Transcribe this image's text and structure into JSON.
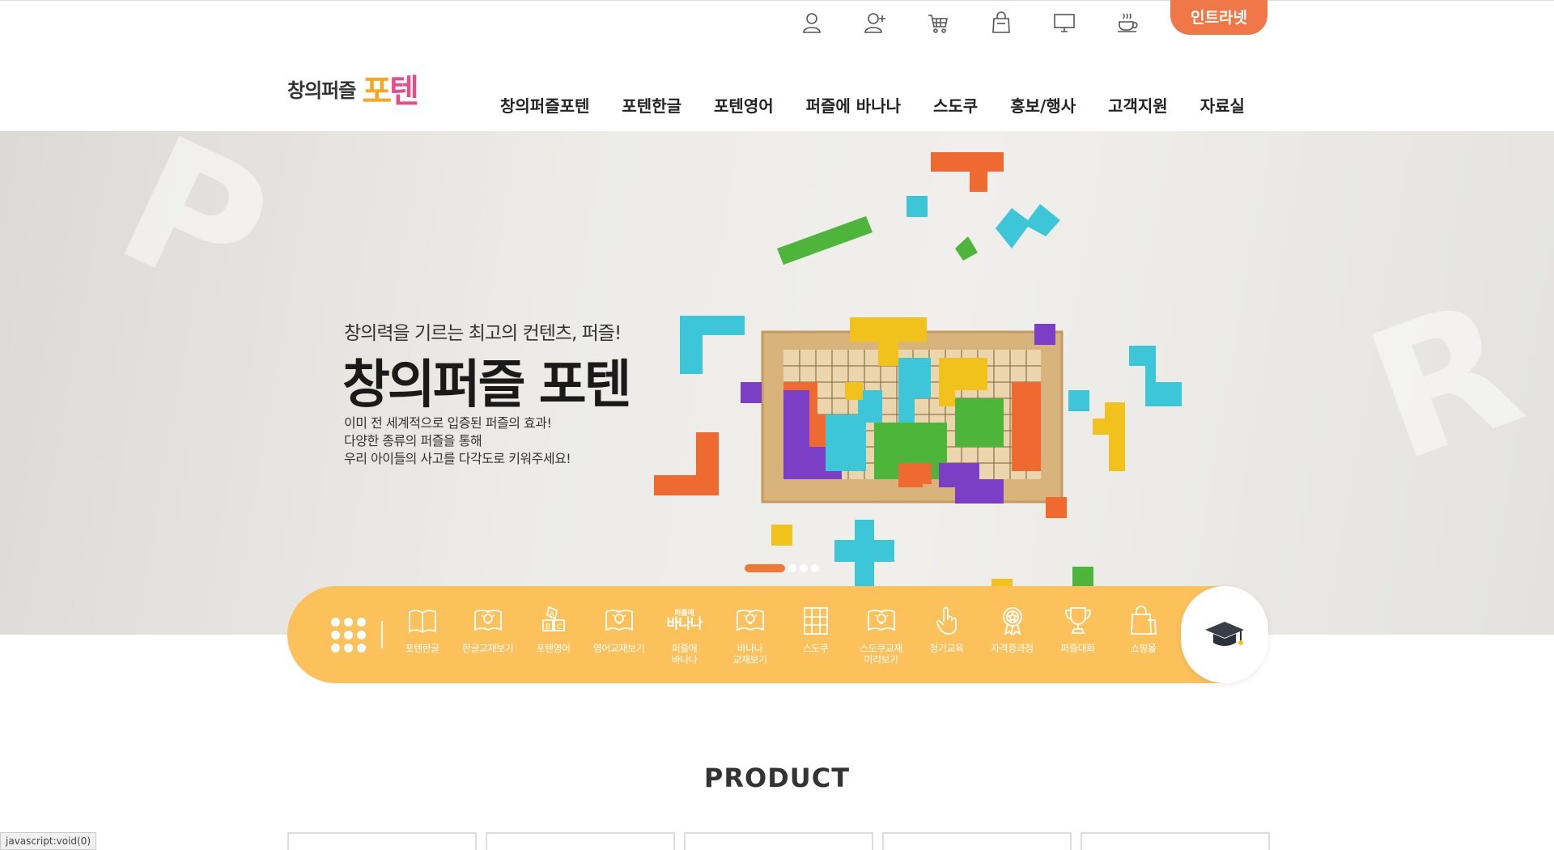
{
  "utility": {
    "icons": [
      "user-icon",
      "user-add-icon",
      "cart-icon",
      "shopping-bag-icon",
      "monitor-icon",
      "coffee-cup-icon"
    ],
    "intranet_label": "인트라넷"
  },
  "logo": {
    "text": "창의퍼즐",
    "mark_1": "포",
    "mark_2": "텐"
  },
  "nav": [
    "창의퍼즐포텐",
    "포텐한글",
    "포텐영어",
    "퍼즐에 바나나",
    "스도쿠",
    "홍보/행사",
    "고객지원",
    "자료실"
  ],
  "hero": {
    "subtitle": "창의력을 기르는 최고의 컨텐츠, 퍼즐!",
    "title": "창의퍼즐 포텐",
    "desc": [
      "이미 전 세계적으로 입증된 퍼즐의 효과!",
      "다양한 종류의 퍼즐을 통해",
      "우리 아이들의 사고를 다각도로 키워주세요!"
    ],
    "slider_active": 1,
    "slider_count": 4
  },
  "quick_menu": {
    "items": [
      {
        "label": "포텐한글",
        "icon": "book-icon"
      },
      {
        "label": "한글교재보기",
        "icon": "bulb-book-icon"
      },
      {
        "label": "포텐영어",
        "icon": "abc-blocks-icon"
      },
      {
        "label": "영어교재보기",
        "icon": "bulb-book-icon"
      },
      {
        "label": "퍼즐에\n바나나",
        "icon": "banana-logo-icon"
      },
      {
        "label": "바나나\n교재보기",
        "icon": "bulb-book-icon"
      },
      {
        "label": "스도쿠",
        "icon": "sudoku-grid-icon"
      },
      {
        "label": "스도쿠교재\n미리보기",
        "icon": "bulb-book-icon"
      },
      {
        "label": "정기교육",
        "icon": "hand-pointer-icon"
      },
      {
        "label": "자격증과정",
        "icon": "medal-icon"
      },
      {
        "label": "퍼즐대회",
        "icon": "trophy-icon"
      },
      {
        "label": "쇼핑몰",
        "icon": "shopping-bag-icon"
      }
    ],
    "banana_logo_top": "퍼즐에",
    "banana_logo_bottom": "바나나",
    "cap_icon": "graduation-cap-icon"
  },
  "product": {
    "title": "PRODUCT",
    "card_count": 5
  },
  "status_bar": "javascript:void(0)",
  "colors": {
    "accent_orange": "#f07848",
    "quick_bar_yellow": "#fcc15a"
  }
}
